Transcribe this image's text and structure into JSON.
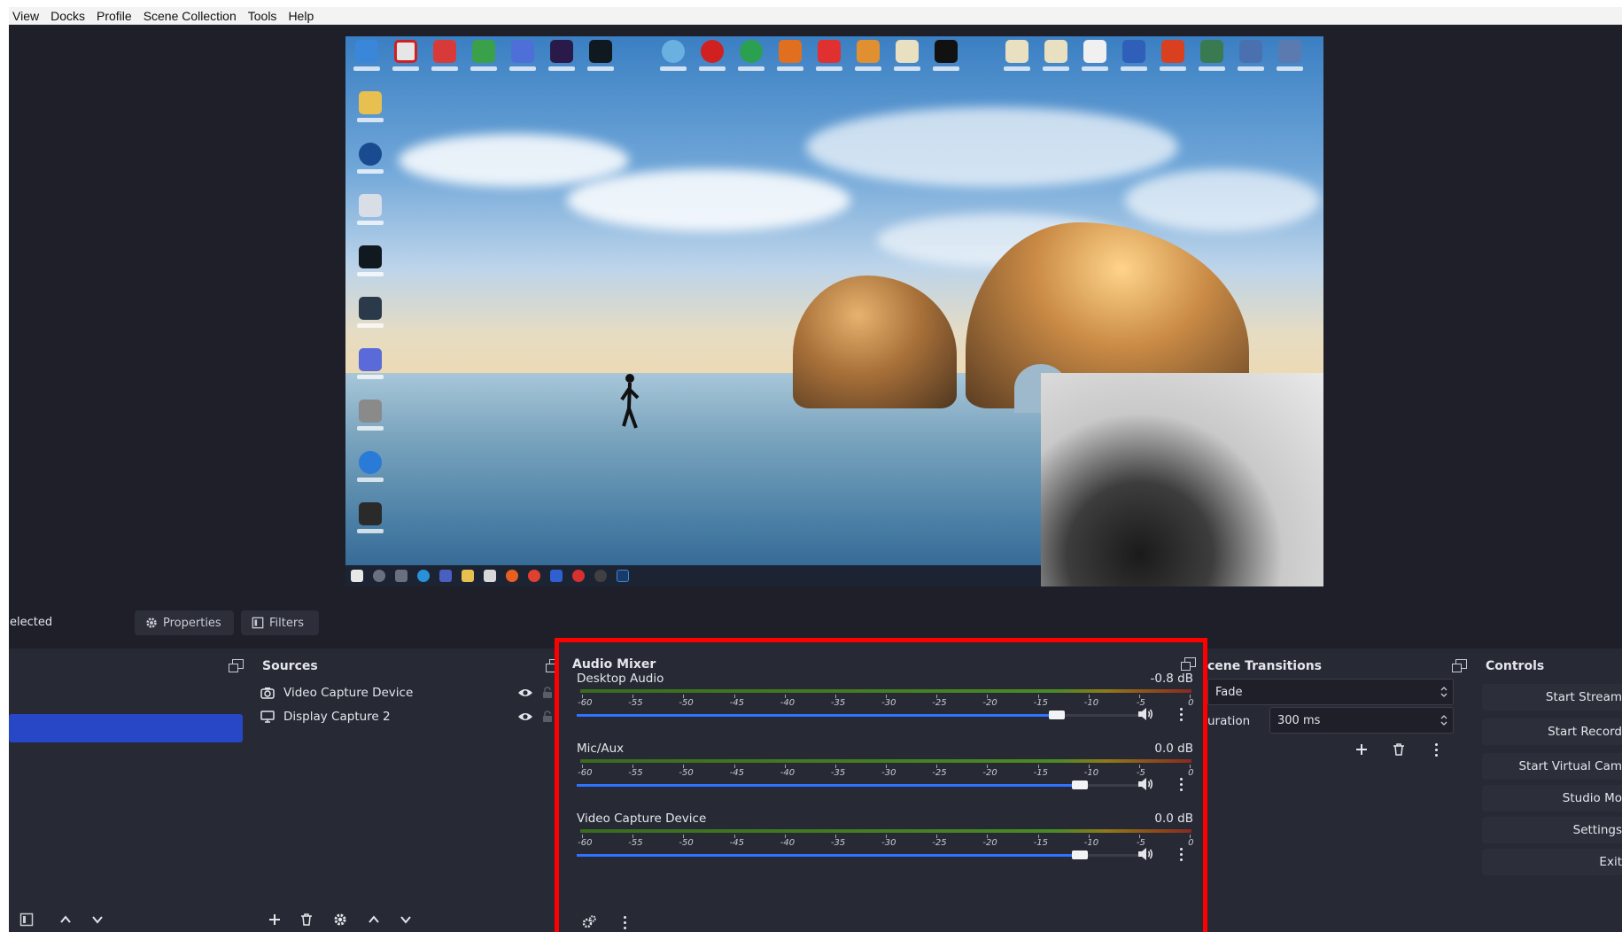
{
  "menu": [
    "View",
    "Docks",
    "Profile",
    "Scene Collection",
    "Tools",
    "Help"
  ],
  "selection_bar": {
    "status": "elected",
    "properties_label": "Properties",
    "filters_label": "Filters"
  },
  "sources": {
    "title": "Sources",
    "items": [
      {
        "label": "Video Capture Device",
        "icon": "camera-icon"
      },
      {
        "label": "Display Capture 2",
        "icon": "monitor-icon"
      }
    ]
  },
  "mixer": {
    "title": "Audio Mixer",
    "tick_labels": [
      "-60",
      "-55",
      "-50",
      "-45",
      "-40",
      "-35",
      "-30",
      "-25",
      "-20",
      "-15",
      "-10",
      "-5",
      "0"
    ],
    "channels": [
      {
        "name": "Desktop Audio",
        "db": "-0.8 dB",
        "volume_fraction": 0.85
      },
      {
        "name": "Mic/Aux",
        "db": "0.0 dB",
        "volume_fraction": 0.89
      },
      {
        "name": "Video Capture Device",
        "db": "0.0 dB",
        "volume_fraction": 0.89
      }
    ]
  },
  "transitions": {
    "title": "cene Transitions",
    "selected": "Fade",
    "duration_label": "uration",
    "duration_value": "300 ms"
  },
  "controls": {
    "title": "Controls",
    "buttons": [
      "Start Stream",
      "Start Record",
      "Start Virtual Cam",
      "Studio Mo",
      "Settings",
      "Exit"
    ]
  },
  "colors": {
    "accent": "#2f73ff",
    "selected_scene": "#2747c6",
    "highlight_box": "#ff0000",
    "dock_bg": "#272935",
    "app_bg": "#1e1f29"
  }
}
